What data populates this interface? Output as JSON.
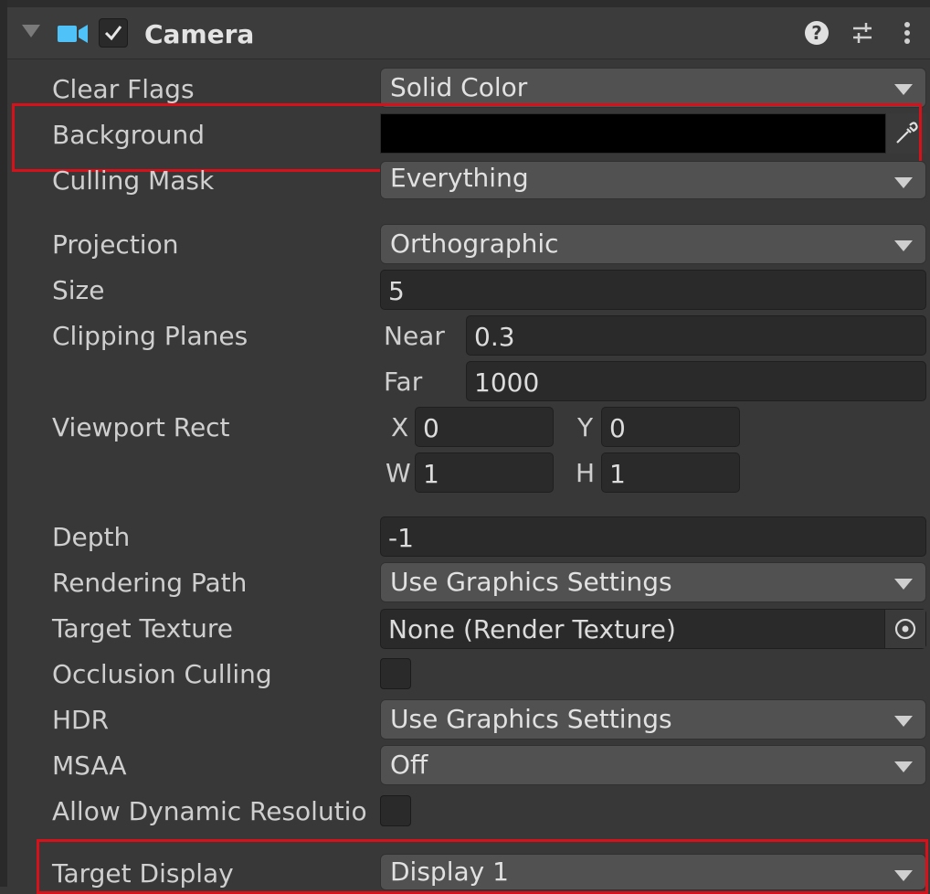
{
  "component": {
    "title": "Camera",
    "enabled": true,
    "icons": [
      "foldout-arrow-icon",
      "camera-icon",
      "checkmark-icon",
      "help-icon",
      "presets-icon",
      "more-menu-icon"
    ]
  },
  "properties": {
    "clear_flags": {
      "label": "Clear Flags",
      "value": "Solid Color"
    },
    "background": {
      "label": "Background",
      "color": "#000000"
    },
    "culling_mask": {
      "label": "Culling Mask",
      "value": "Everything"
    },
    "projection": {
      "label": "Projection",
      "value": "Orthographic"
    },
    "size": {
      "label": "Size",
      "value": "5"
    },
    "clipping_planes": {
      "label": "Clipping Planes",
      "near_label": "Near",
      "near": "0.3",
      "far_label": "Far",
      "far": "1000"
    },
    "viewport_rect": {
      "label": "Viewport Rect",
      "x_label": "X",
      "x": "0",
      "y_label": "Y",
      "y": "0",
      "w_label": "W",
      "w": "1",
      "h_label": "H",
      "h": "1"
    },
    "depth": {
      "label": "Depth",
      "value": "-1"
    },
    "rendering_path": {
      "label": "Rendering Path",
      "value": "Use Graphics Settings"
    },
    "target_texture": {
      "label": "Target Texture",
      "value": "None (Render Texture)"
    },
    "occlusion_culling": {
      "label": "Occlusion Culling",
      "checked": false
    },
    "hdr": {
      "label": "HDR",
      "value": "Use Graphics Settings"
    },
    "msaa": {
      "label": "MSAA",
      "value": "Off"
    },
    "allow_dynamic_resolution": {
      "label": "Allow Dynamic Resolutio",
      "checked": false
    },
    "target_display": {
      "label": "Target Display",
      "value": "Display 1"
    }
  },
  "highlight_color": "#d8101a",
  "accent_color": "#4fc3f7"
}
